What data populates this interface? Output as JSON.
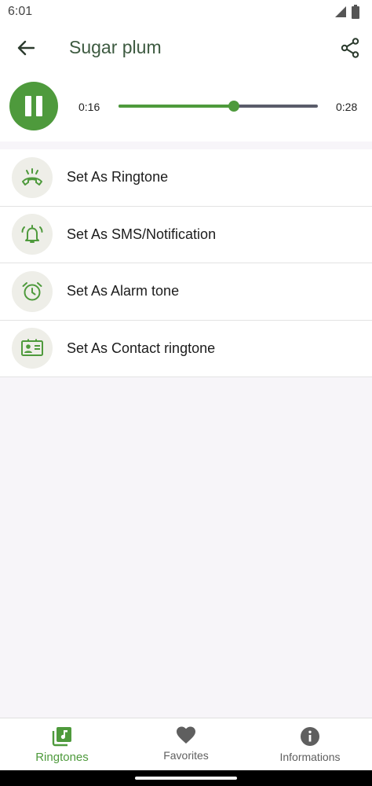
{
  "status_bar": {
    "time": "6:01",
    "icons": [
      "signal-icon",
      "battery-icon"
    ]
  },
  "app_bar": {
    "title": "Sugar plum",
    "back_icon": "arrow-left-icon",
    "share_icon": "share-icon"
  },
  "player": {
    "state_icon": "pause-icon",
    "current_time": "0:16",
    "total_time": "0:28",
    "progress": 0.58
  },
  "actions": [
    {
      "label": "Set As Ringtone",
      "icon": "ringing-phone-icon"
    },
    {
      "label": "Set As SMS/Notification",
      "icon": "notification-bell-icon"
    },
    {
      "label": "Set As Alarm tone",
      "icon": "alarm-clock-icon"
    },
    {
      "label": "Set As Contact ringtone",
      "icon": "contact-card-icon"
    }
  ],
  "bottom_nav": [
    {
      "label": "Ringtones",
      "icon": "music-library-icon",
      "active": true
    },
    {
      "label": "Favorites",
      "icon": "heart-icon",
      "active": false
    },
    {
      "label": "Informations",
      "icon": "info-icon",
      "active": false
    }
  ],
  "colors": {
    "accent": "#4e9a3c",
    "title": "#3d5a40",
    "icon_bg": "#eeeee8",
    "track": "#5a5c6a",
    "nav_inactive": "#5f5f5f"
  }
}
